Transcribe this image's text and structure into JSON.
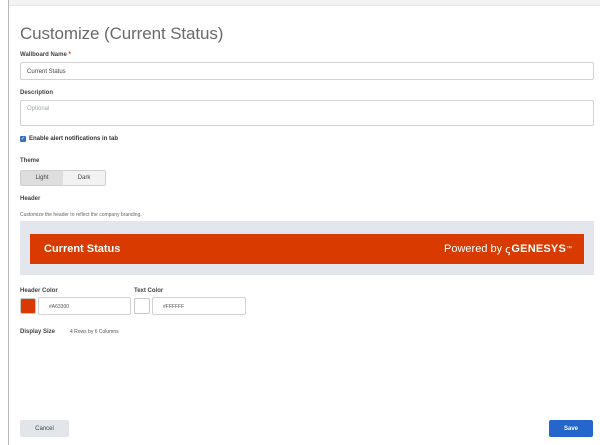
{
  "page": {
    "title": "Customize (Current Status)"
  },
  "form": {
    "name_label": "Wallboard Name",
    "required_mark": "*",
    "name_value": "Current Status",
    "description_label": "Description",
    "description_placeholder": "Optional",
    "alert_checked": true,
    "alert_label": "Enable alert notifications in tab",
    "theme_label": "Theme",
    "theme_options": [
      "Light",
      "Dark"
    ],
    "theme_selected": "Light",
    "header_label": "Header",
    "header_help": "Customize the header to reflect the company branding.",
    "preview_title": "Current Status",
    "preview_powered_by": "Powered by",
    "preview_brand_mark": "ꞔ",
    "preview_brand_name": "GENESYS",
    "preview_trademark": "™",
    "header_color_label": "Header Color",
    "header_color_value": "#A63300",
    "text_color_label": "Text Color",
    "text_color_value": "#FFFFFF",
    "display_size_label": "Display Size",
    "display_size_value": "4 Rows by 6 Columns"
  },
  "colors": {
    "header_color": "#d83a00",
    "text_color": "#ffffff",
    "primary_button": "#2466cc"
  },
  "actions": {
    "cancel_label": "Cancel",
    "save_label": "Save"
  }
}
